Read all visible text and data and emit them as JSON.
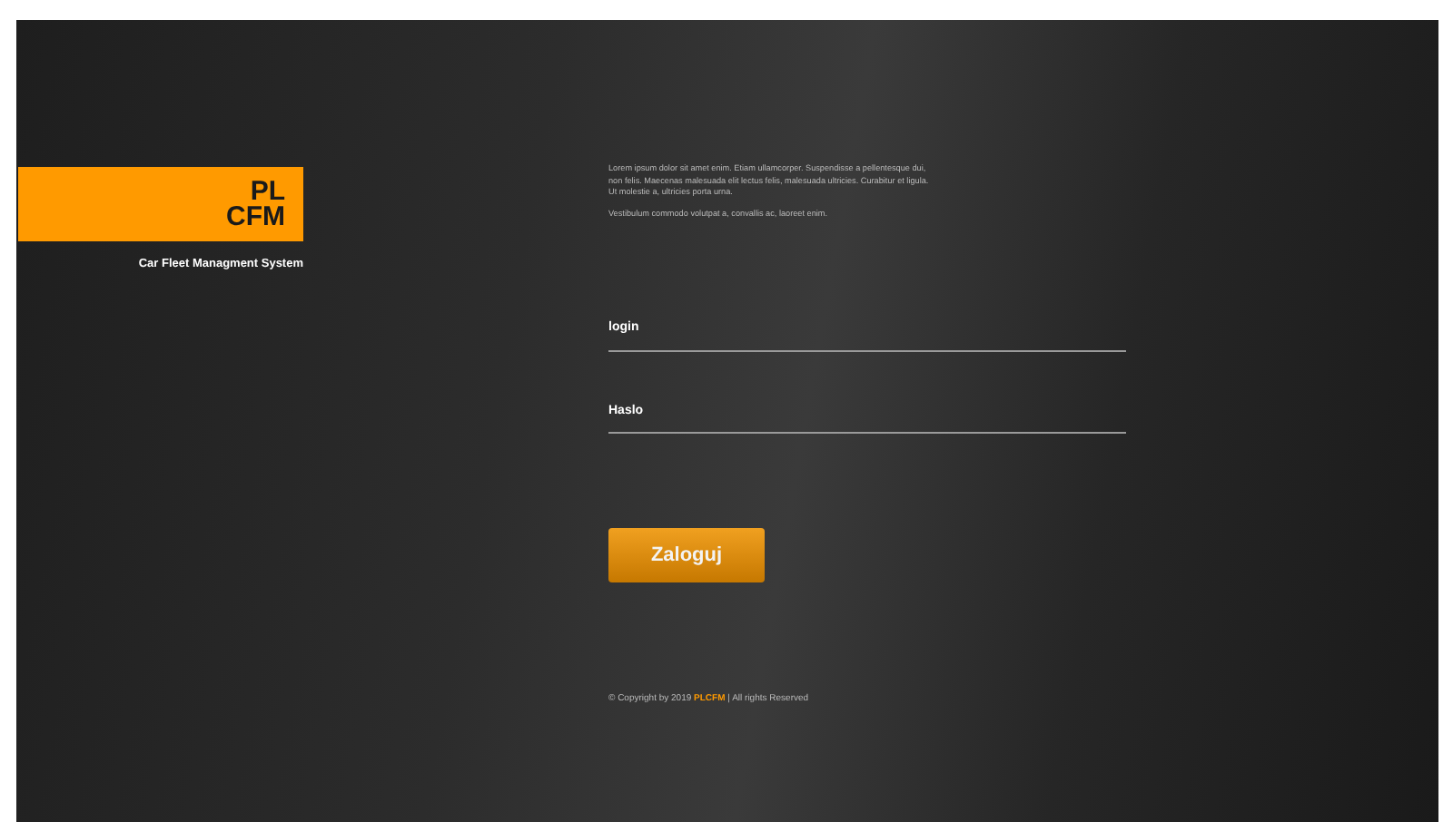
{
  "logo": {
    "line1": "PL",
    "line2": "CFM",
    "tagline": "Car Fleet Managment System"
  },
  "intro": [
    "Lorem ipsum dolor sit amet enim. Etiam ullamcorper. Suspendisse a pellentesque dui, non felis. Maecenas malesuada elit lectus felis, malesuada ultricies. Curabitur et ligula. Ut molestie a, ultricies porta urna.",
    "Vestibulum commodo volutpat a, convallis ac, laoreet enim."
  ],
  "fields": [
    {
      "label": "login"
    },
    {
      "label": "Haslo"
    }
  ],
  "login_button": "Zaloguj",
  "footer": {
    "prefix": "© Copyright by 2019",
    "brand": "PLCFM",
    "suffix": "| All rights Reserved"
  }
}
